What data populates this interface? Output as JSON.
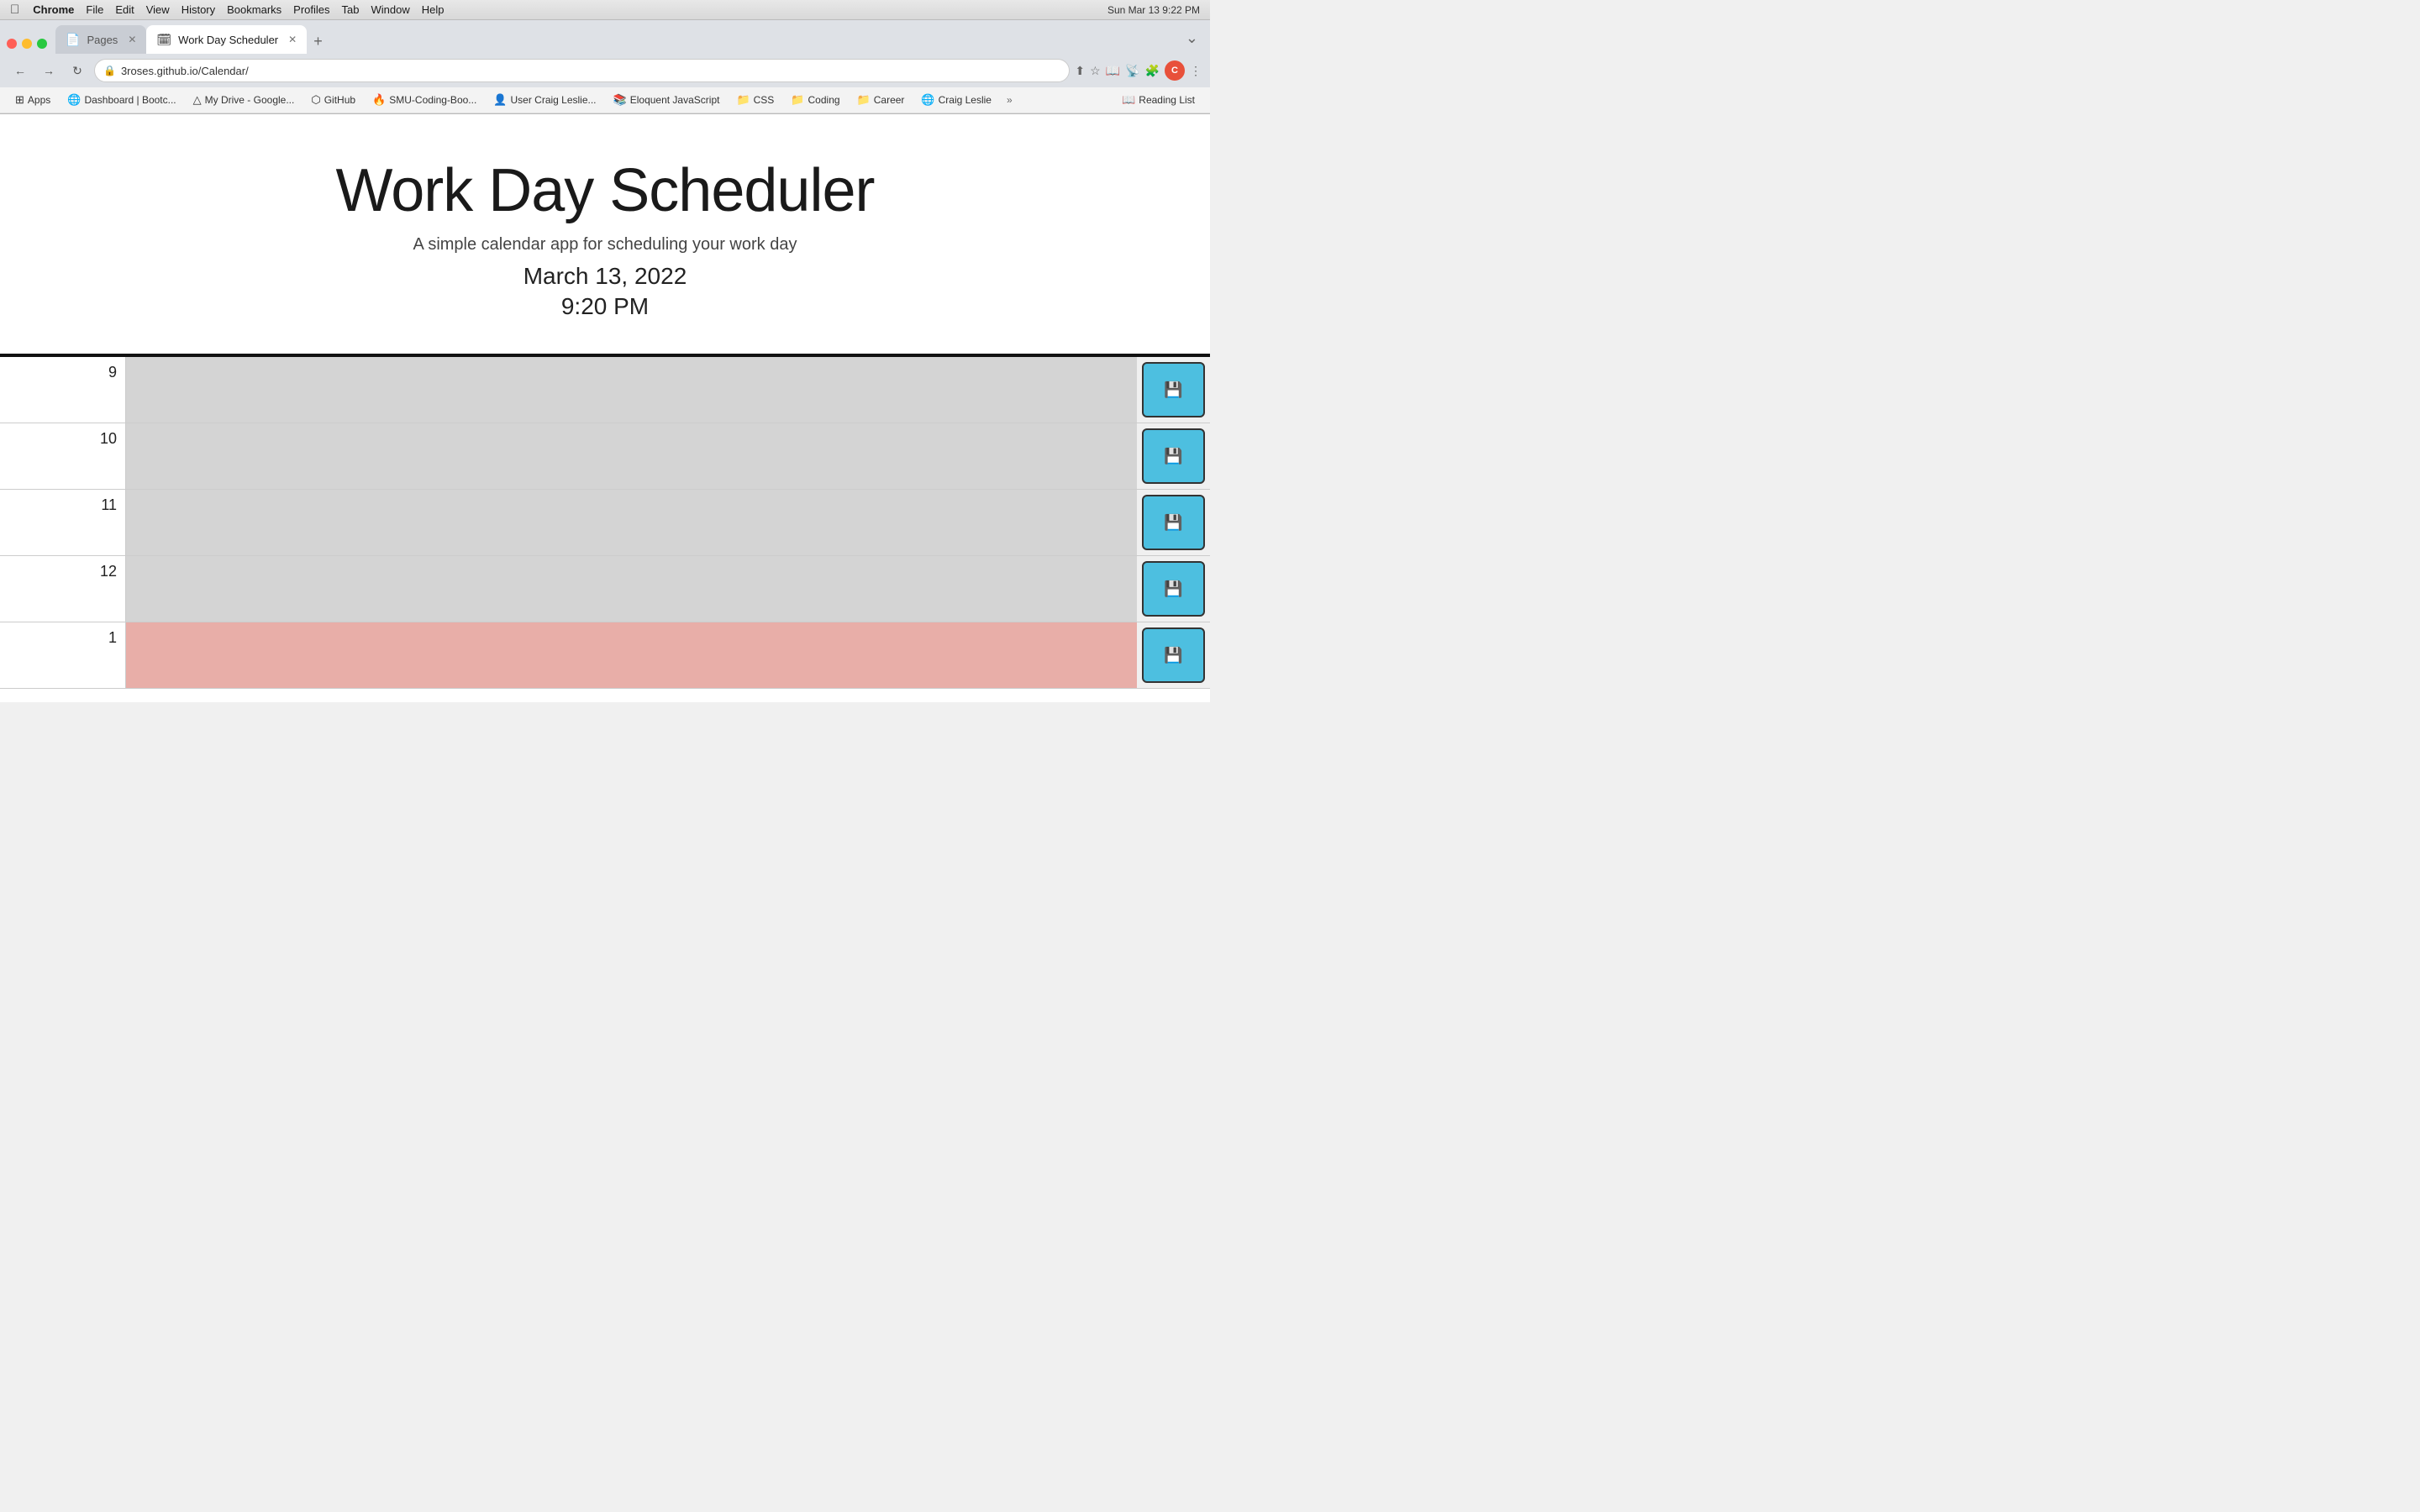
{
  "os": {
    "title": "macOS",
    "apple": "&#63743;",
    "time": "Sun Mar 13  9:22 PM"
  },
  "menubar": {
    "items": [
      "Chrome",
      "File",
      "Edit",
      "View",
      "History",
      "Bookmarks",
      "Profiles",
      "Tab",
      "Window",
      "Help"
    ]
  },
  "window_controls": {
    "close": "close",
    "minimize": "minimize",
    "maximize": "maximize"
  },
  "tabs": [
    {
      "id": "pages",
      "label": "Pages",
      "icon": "📄",
      "active": false
    },
    {
      "id": "scheduler",
      "label": "Work Day Scheduler",
      "icon": "🗓",
      "active": true
    }
  ],
  "address_bar": {
    "url": "3roses.github.io/Calendar/"
  },
  "bookmarks": [
    {
      "id": "apps",
      "label": "Apps",
      "icon": "⊞"
    },
    {
      "id": "dashboard",
      "label": "Dashboard | Bootc...",
      "icon": "🌐"
    },
    {
      "id": "drive",
      "label": "My Drive - Google...",
      "icon": "△"
    },
    {
      "id": "github",
      "label": "GitHub",
      "icon": "⬡"
    },
    {
      "id": "smu",
      "label": "SMU-Coding-Boo...",
      "icon": "🔥"
    },
    {
      "id": "user-craig",
      "label": "User Craig Leslie...",
      "icon": "👤"
    },
    {
      "id": "eloquent",
      "label": "Eloquent JavaScript",
      "icon": "📚"
    },
    {
      "id": "css",
      "label": "CSS",
      "icon": "📁"
    },
    {
      "id": "coding",
      "label": "Coding",
      "icon": "📁"
    },
    {
      "id": "career",
      "label": "Career",
      "icon": "📁"
    },
    {
      "id": "craig-leslie",
      "label": "Craig Leslie",
      "icon": "🌐"
    }
  ],
  "reading_list": {
    "label": "Reading List"
  },
  "app": {
    "title": "Work Day Scheduler",
    "subtitle": "A simple calendar app for scheduling your work day",
    "date": "March 13, 2022",
    "time": "9:20 PM"
  },
  "schedule": {
    "hours": [
      {
        "hour": "9",
        "status": "future"
      },
      {
        "hour": "10",
        "status": "future"
      },
      {
        "hour": "11",
        "status": "future"
      },
      {
        "hour": "12",
        "status": "future"
      },
      {
        "hour": "1",
        "status": "past"
      }
    ],
    "save_icon": "💾"
  }
}
